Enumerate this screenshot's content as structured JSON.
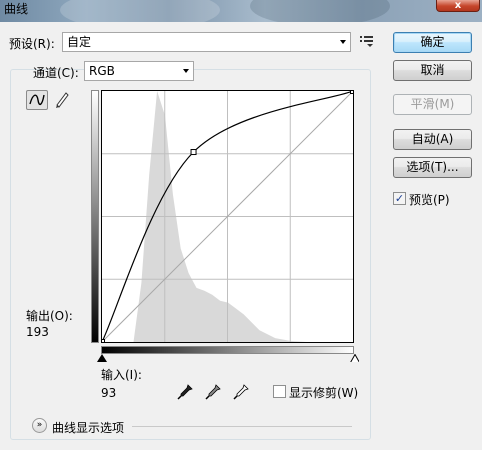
{
  "window": {
    "title": "曲线",
    "close_label": "x"
  },
  "preset": {
    "label": "预设(R):",
    "value": "自定"
  },
  "channel": {
    "label": "通道(C):",
    "value": "RGB"
  },
  "buttons": {
    "ok": "确定",
    "cancel": "取消",
    "smooth": "平滑(M)",
    "auto": "自动(A)",
    "options": "选项(T)..."
  },
  "preview": {
    "label": "预览(P)",
    "checked": true,
    "mark": "✓"
  },
  "output": {
    "label": "输出(O):",
    "value": "193"
  },
  "input": {
    "label": "输入(I):",
    "value": "93"
  },
  "show_clipping": {
    "label": "显示修剪(W)",
    "checked": false
  },
  "curve_options": {
    "label": "曲线显示选项",
    "icon": "»"
  },
  "icons": {
    "preset_menu": "preset-menu-icon",
    "curve_tool": "curve-tool-icon",
    "pencil_tool": "pencil-tool-icon",
    "black_eyedropper": "black-eyedropper-icon",
    "gray_eyedropper": "gray-eyedropper-icon",
    "white_eyedropper": "white-eyedropper-icon",
    "expand": "expand-icon"
  },
  "chart_data": {
    "type": "line",
    "x_range": [
      0,
      255
    ],
    "y_range": [
      0,
      255
    ],
    "grid_divisions": 4,
    "series": [
      {
        "x": [
          0,
          255
        ],
        "y": [
          0,
          255
        ]
      },
      {
        "x": [
          0,
          93,
          255
        ],
        "y": [
          0,
          193,
          255
        ]
      }
    ],
    "selected_point": {
      "x": 93,
      "y": 193
    },
    "histogram": {
      "x": [
        0,
        16,
        32,
        40,
        48,
        56,
        64,
        72,
        80,
        88,
        96,
        104,
        112,
        120,
        128,
        136,
        144,
        160,
        176,
        192,
        208,
        224,
        240,
        255
      ],
      "y": [
        0,
        0,
        0,
        60,
        170,
        255,
        230,
        150,
        95,
        70,
        55,
        52,
        48,
        42,
        40,
        34,
        28,
        12,
        4,
        1,
        0,
        0,
        0,
        0
      ]
    },
    "colors": {
      "histogram": "#d9d9d9",
      "grid": "#bfbfbf",
      "curve": "#000000",
      "baseline": "#a9a9a9"
    }
  }
}
